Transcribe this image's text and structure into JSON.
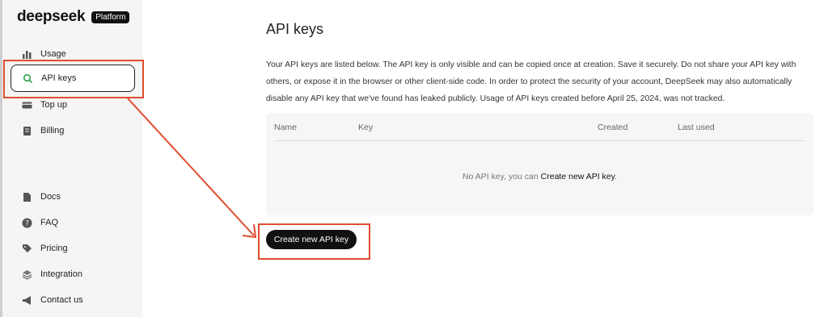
{
  "brand": {
    "name": "deepseek",
    "badge": "Platform"
  },
  "sidebar": {
    "items": [
      {
        "label": "Usage",
        "icon": "bar-chart-icon"
      },
      {
        "label": "API keys",
        "icon": "search-icon",
        "active": true
      },
      {
        "label": "Top up",
        "icon": "card-icon"
      },
      {
        "label": "Billing",
        "icon": "billing-icon"
      }
    ],
    "bottom_items": [
      {
        "label": "Docs",
        "icon": "document-icon"
      },
      {
        "label": "FAQ",
        "icon": "question-icon"
      },
      {
        "label": "Pricing",
        "icon": "tag-icon"
      },
      {
        "label": "Integration",
        "icon": "layers-icon"
      },
      {
        "label": "Contact us",
        "icon": "megaphone-icon"
      }
    ]
  },
  "main": {
    "title": "API keys",
    "description": "Your API keys are listed below. The API key is only visible and can be copied once at creation. Save it securely. Do not share your API key with others, or expose it in the browser or other client-side code. In order to protect the security of your account, DeepSeek may also automatically disable any API key that we've found has leaked publicly. Usage of API keys created before April 25, 2024, was not tracked.",
    "table": {
      "columns": [
        "Name",
        "Key",
        "Created",
        "Last used"
      ],
      "empty_prefix": "No API key, you can ",
      "empty_link": "Create new API key",
      "empty_suffix": "."
    },
    "create_button": "Create new API key"
  },
  "annotation": {
    "color": "#e04e2f"
  }
}
